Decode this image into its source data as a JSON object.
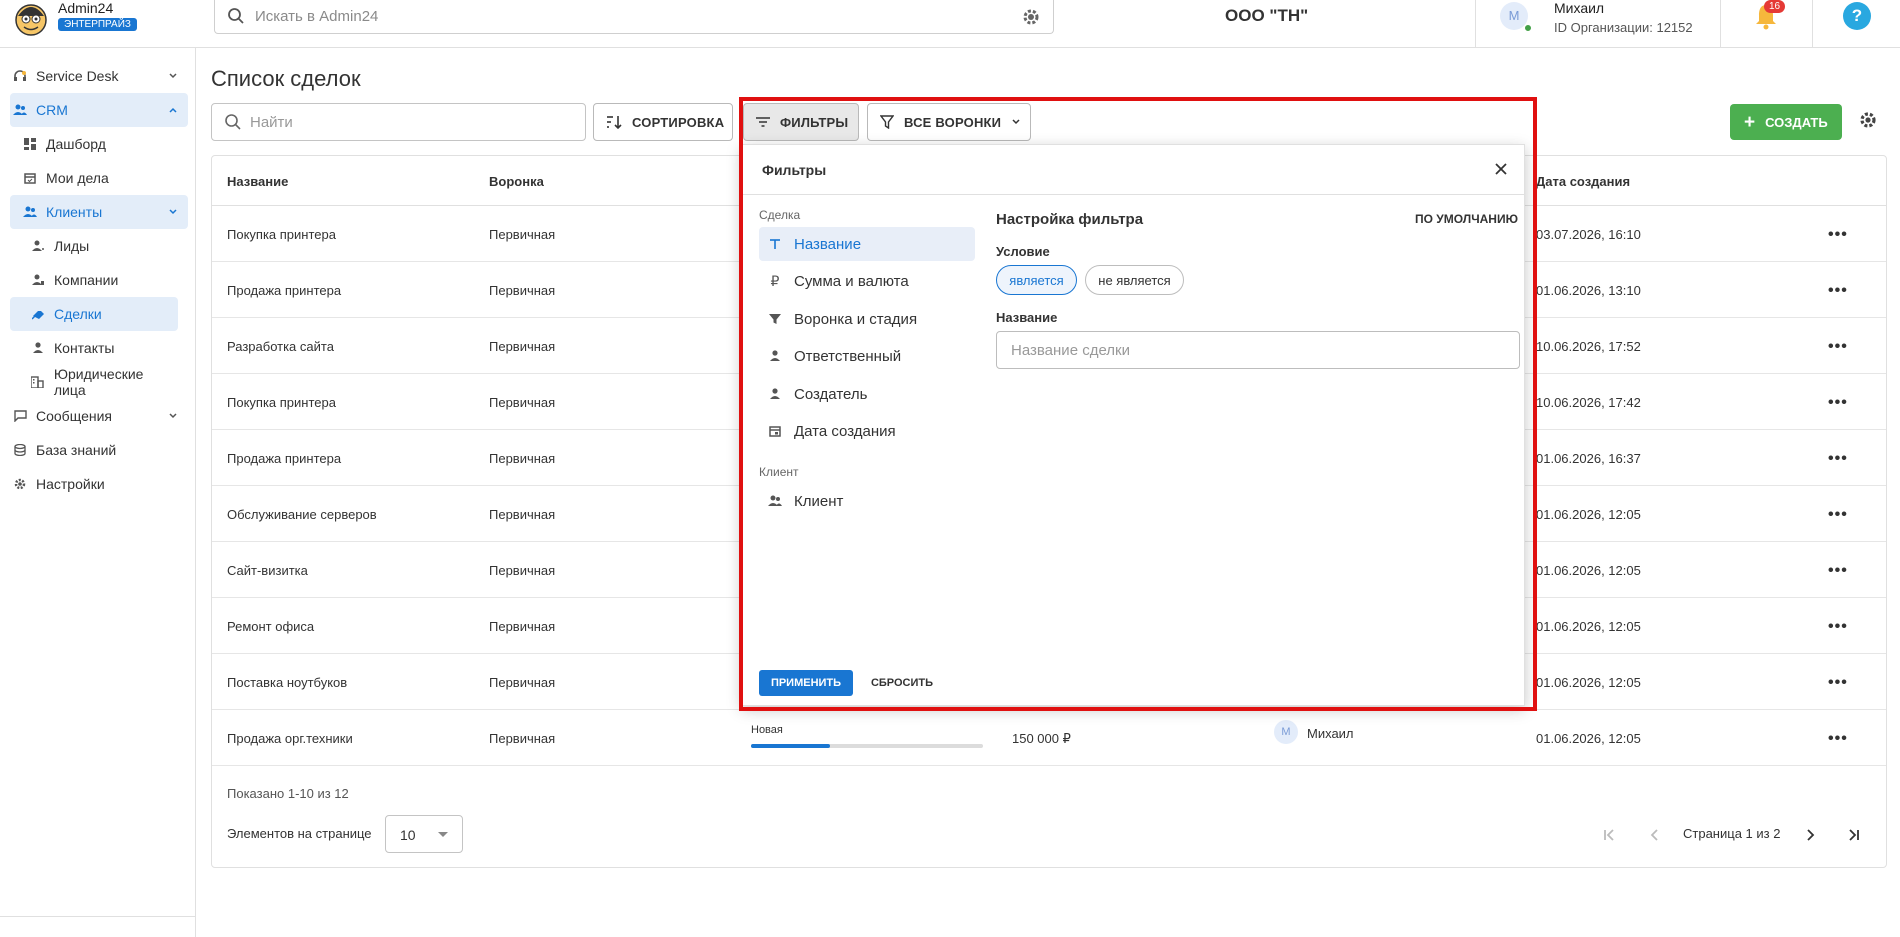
{
  "app": {
    "name": "Admin24",
    "plan_badge": "ЭНТЕРПРАЙЗ"
  },
  "topbar": {
    "search_placeholder": "Искать в Admin24",
    "org_name": "ООО \"ТН\"",
    "user_initial": "М",
    "user_name": "Михаил",
    "user_org": "ID Организации: 12152",
    "notifications_count": "16",
    "help": "?"
  },
  "sidebar": {
    "items": [
      {
        "label": "Service Desk",
        "icon": "headset-icon"
      },
      {
        "label": "CRM",
        "icon": "users-icon"
      },
      {
        "label": "Дашборд",
        "icon": "dashboard-icon"
      },
      {
        "label": "Мои дела",
        "icon": "calendar-icon"
      },
      {
        "label": "Клиенты",
        "icon": "users-icon"
      },
      {
        "label": "Лиды",
        "icon": "lead-icon"
      },
      {
        "label": "Компании",
        "icon": "company-icon"
      },
      {
        "label": "Сделки",
        "icon": "handshake-icon"
      },
      {
        "label": "Контакты",
        "icon": "person-icon"
      },
      {
        "label": "Юридические лица",
        "icon": "building-icon"
      },
      {
        "label": "Сообщения",
        "icon": "message-icon"
      },
      {
        "label": "База знаний",
        "icon": "database-icon"
      },
      {
        "label": "Настройки",
        "icon": "gear-icon"
      }
    ]
  },
  "page": {
    "title": "Список сделок"
  },
  "toolbar": {
    "find_placeholder": "Найти",
    "sort_label": "СОРТИРОВКА",
    "filters_label": "ФИЛЬТРЫ",
    "funnels_label": "ВСЕ ВОРОНКИ",
    "create_label": "СОЗДАТЬ"
  },
  "table": {
    "columns": {
      "name": "Название",
      "funnel": "Воронка",
      "created": "Дата создания"
    },
    "rows": [
      {
        "name": "Покупка принтера",
        "funnel": "Первичная",
        "created": "03.07.2026, 16:10"
      },
      {
        "name": "Продажа принтера",
        "funnel": "Первичная",
        "created": "01.06.2026, 13:10"
      },
      {
        "name": "Разработка сайта",
        "funnel": "Первичная",
        "created": "10.06.2026, 17:52"
      },
      {
        "name": "Покупка принтера",
        "funnel": "Первичная",
        "created": "10.06.2026, 17:42"
      },
      {
        "name": "Продажа принтера",
        "funnel": "Первичная",
        "created": "01.06.2026, 16:37"
      },
      {
        "name": "Обслуживание серверов",
        "funnel": "Первичная",
        "created": "01.06.2026, 12:05"
      },
      {
        "name": "Сайт-визитка",
        "funnel": "Первичная",
        "created": "01.06.2026, 12:05"
      },
      {
        "name": "Ремонт офиса",
        "funnel": "Первичная",
        "created": "01.06.2026, 12:05"
      },
      {
        "name": "Поставка ноутбуков",
        "funnel": "Первичная",
        "created": "01.06.2026, 12:05"
      },
      {
        "name": "Продажа орг.техники",
        "funnel": "Первичная",
        "created": "01.06.2026, 12:05",
        "stage": "Новая",
        "stage_progress": 0.34,
        "amount": "150 000 ₽",
        "responsible_initial": "М",
        "responsible": "Михаил"
      }
    ],
    "row_menu": "•••"
  },
  "footer": {
    "shown": "Показано 1-10 из 12",
    "per_page_label": "Элементов на странице",
    "per_page_value": "10",
    "page_text": "Страница 1 из 2"
  },
  "filter_popup": {
    "title": "Фильтры",
    "group_deal": "Сделка",
    "deal_fields": [
      {
        "label": "Название",
        "icon": "text-icon"
      },
      {
        "label": "Сумма и валюта",
        "icon": "ruble-icon"
      },
      {
        "label": "Воронка и стадия",
        "icon": "funnel-icon"
      },
      {
        "label": "Ответственный",
        "icon": "person-icon"
      },
      {
        "label": "Создатель",
        "icon": "person-icon"
      },
      {
        "label": "Дата создания",
        "icon": "calendar-icon"
      }
    ],
    "group_client": "Клиент",
    "client_fields": [
      {
        "label": "Клиент",
        "icon": "users-icon"
      }
    ],
    "settings_title": "Настройка фильтра",
    "default_label": "ПО УМОЛЧАНИЮ",
    "condition_label": "Условие",
    "condition_options": [
      "является",
      "не является"
    ],
    "name_label": "Название",
    "name_placeholder": "Название сделки",
    "apply_label": "ПРИМЕНИТЬ",
    "reset_label": "СБРОСИТЬ"
  },
  "colors": {
    "accent": "#1976d2",
    "create": "#4caf50",
    "highlight": "#e01010",
    "badge": "#e53935"
  }
}
